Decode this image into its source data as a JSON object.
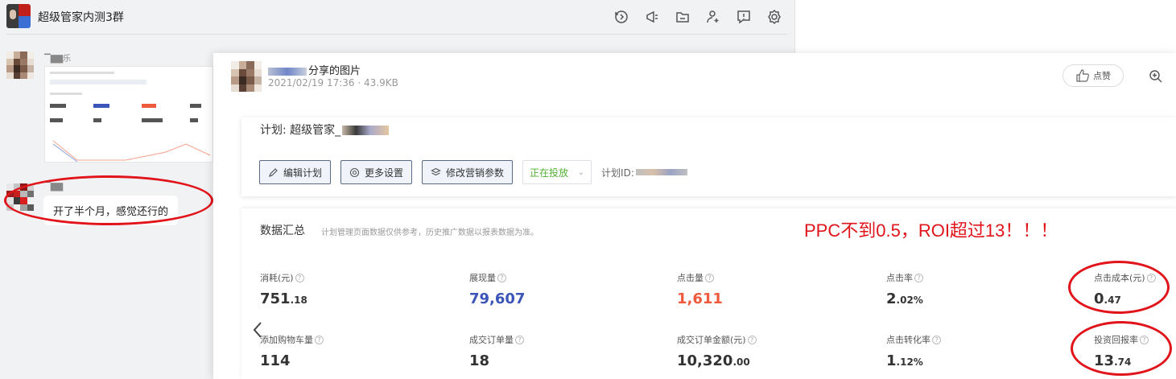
{
  "chat": {
    "title": "超级管家内测3群",
    "header_icons": [
      "history-icon",
      "announcement-icon",
      "folder-icon",
      "add-member-icon",
      "report-icon",
      "gear-icon"
    ],
    "messages": [
      {
        "sender": "▔▇▇乐",
        "type": "image"
      },
      {
        "sender": "▔▇▇",
        "type": "text",
        "text": "开了半个月，感觉还行的"
      }
    ]
  },
  "viewer": {
    "title_suffix": "分享的图片",
    "meta": "2021/02/19 17:36 · 43.9KB",
    "like_label": "点赞",
    "plan": {
      "label": "计划: 超级管家_",
      "buttons": [
        "编辑计划",
        "更多设置",
        "修改营销参数"
      ],
      "status": "正在投放",
      "plan_id_label": "计划ID:"
    },
    "summary": {
      "title": "数据汇总",
      "note": "计划管理页面数据仅供参考，历史推广数据以报表数据为准。",
      "annotation": "PPC不到0.5，ROI超过13！！！",
      "metrics": [
        {
          "label": "消耗(元)",
          "int": "751",
          "dec": ".18",
          "color": "#333333"
        },
        {
          "label": "展现量",
          "int": "79,607",
          "dec": "",
          "color": "#3b55b8"
        },
        {
          "label": "点击量",
          "int": "1,611",
          "dec": "",
          "color": "#f05a3c"
        },
        {
          "label": "点击率",
          "int": "2",
          "dec": ".02%",
          "color": "#333333"
        },
        {
          "label": "点击成本(元)",
          "int": "0",
          "dec": ".47",
          "color": "#333333"
        },
        {
          "label": "添加购物车量",
          "int": "114",
          "dec": "",
          "color": "#333333"
        },
        {
          "label": "成交订单量",
          "int": "18",
          "dec": "",
          "color": "#333333"
        },
        {
          "label": "成交订单金额(元)",
          "int": "10,320",
          "dec": ".00",
          "color": "#333333"
        },
        {
          "label": "点击转化率",
          "int": "1",
          "dec": ".12%",
          "color": "#333333"
        },
        {
          "label": "投资回报率",
          "int": "13",
          "dec": ".74",
          "color": "#333333"
        }
      ]
    }
  },
  "colors": {
    "accent_red": "#e0141a",
    "status_green": "#52b033",
    "impression_blue": "#3b55b8",
    "click_orange": "#f05a3c"
  }
}
